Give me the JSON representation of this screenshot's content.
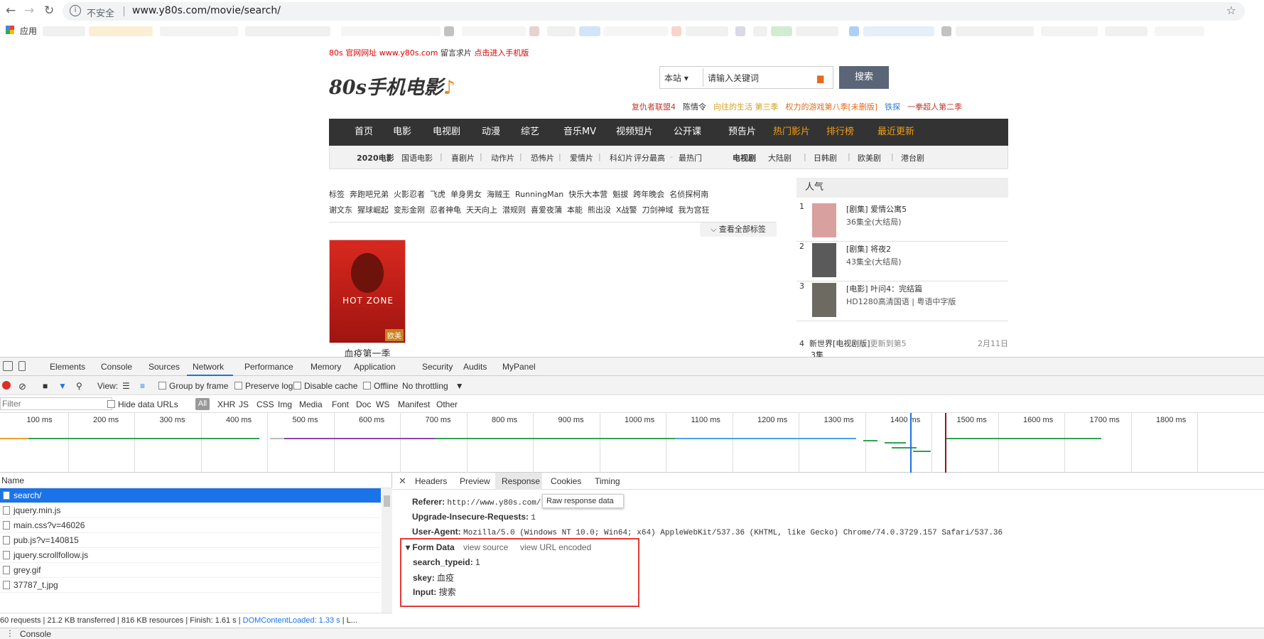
{
  "browser": {
    "back_icon": "back-arrow-icon",
    "forward_icon": "forward-arrow-icon",
    "reload_icon": "reload-icon",
    "security_label": "不安全",
    "url": "www.y80s.com/movie/search/",
    "bookmarks_apps_label": "应用"
  },
  "site": {
    "top_note_red": "80s 官网网址 www.y80s.com",
    "top_note_black": " 留言求片 ",
    "top_note_red2": "点击进入手机版",
    "logo_text": "80s手机电影",
    "logo_icon": "♪",
    "search_scope": "本站",
    "search_input_value": "请输入关键词",
    "search_button": "搜索",
    "hot_links": [
      {
        "text": "复仇者联盟4",
        "color": "#c0392b"
      },
      {
        "text": "陈情令",
        "color": "#333333"
      },
      {
        "text": "向往的生活 第三季",
        "color": "#d4a017"
      },
      {
        "text": "权力的游戏第八季[未删版]",
        "color": "#e36b1f"
      },
      {
        "text": "铁探",
        "color": "#2b7cd3"
      },
      {
        "text": "一拳超人第二季",
        "color": "#c0392b"
      }
    ],
    "main_nav": [
      {
        "label": "首页",
        "color": "#ffffff"
      },
      {
        "label": "电影",
        "color": "#ffffff"
      },
      {
        "label": "电视剧",
        "color": "#ffffff"
      },
      {
        "label": "动漫",
        "color": "#ffffff"
      },
      {
        "label": "综艺",
        "color": "#ffffff"
      },
      {
        "label": "音乐MV",
        "color": "#ffffff"
      },
      {
        "label": "视频短片",
        "color": "#ffffff"
      },
      {
        "label": "公开课",
        "color": "#ffffff"
      },
      {
        "label": "预告片",
        "color": "#ffffff"
      },
      {
        "label": "热门影片",
        "color": "#f39c12"
      },
      {
        "label": "排行榜",
        "color": "#f39c12"
      },
      {
        "label": "最近更新",
        "color": "#f39c12"
      }
    ],
    "sub_nav": [
      "2020电影",
      "国语电影",
      "|",
      "喜剧片",
      "|",
      "动作片",
      "|",
      "恐怖片",
      "|",
      "爱情片",
      "|",
      "科幻片",
      "评分最高",
      "-",
      "最热门",
      "电视剧",
      "大陆剧",
      "|",
      "日韩剧",
      "|",
      "欧美剧",
      "|",
      "港台剧"
    ],
    "tags_row1": [
      "标签",
      "奔跑吧兄弟",
      "火影忍者",
      "飞虎",
      "单身男女",
      "海贼王",
      "RunningMan",
      "快乐大本营",
      "魁拔",
      "跨年晚会",
      "名侦探柯南"
    ],
    "tags_row2": [
      "谢文东",
      "猩球崛起",
      "变形金刚",
      "忍者神龟",
      "天天向上",
      "潜规则",
      "喜爱夜蒲",
      "本能",
      "熊出没",
      "X战警",
      "刀剑神域",
      "我为宫狂"
    ],
    "view_all_tags": "查看全部标签",
    "result": {
      "poster_text": "HOT ZONE",
      "badge": "欧美",
      "title": "血疫第一季"
    },
    "popular_title": "人气",
    "popular": [
      {
        "rank": "1",
        "title": "[剧集] 爱情公寓5",
        "sub": "36集全(大结局)"
      },
      {
        "rank": "2",
        "title": "[剧集] 将夜2",
        "sub": "43集全(大结局)"
      },
      {
        "rank": "3",
        "title": "[电影] 叶问4：完结篇",
        "sub": "HD1280高清国语 | 粤语中字版"
      }
    ],
    "popular4": {
      "rank": "4",
      "title": "新世界[电视剧版]",
      "update": "更新到第5",
      "ep": "3集",
      "date": "2月11日"
    }
  },
  "devtools": {
    "tabs": [
      "Elements",
      "Console",
      "Sources",
      "Network",
      "Performance",
      "Memory",
      "Application",
      "Security",
      "Audits",
      "MyPanel"
    ],
    "active_tab": "Network",
    "toolbar": {
      "view_label": "View:",
      "group_by_frame": "Group by frame",
      "preserve_log": "Preserve log",
      "disable_cache": "Disable cache",
      "offline": "Offline",
      "throttling": "No throttling"
    },
    "filter": {
      "placeholder": "Filter",
      "hide_data_urls": "Hide data URLs",
      "types": [
        "All",
        "XHR",
        "JS",
        "CSS",
        "Img",
        "Media",
        "Font",
        "Doc",
        "WS",
        "Manifest",
        "Other"
      ]
    },
    "timeline_ticks": [
      "100 ms",
      "200 ms",
      "300 ms",
      "400 ms",
      "500 ms",
      "600 ms",
      "700 ms",
      "800 ms",
      "900 ms",
      "1000 ms",
      "1100 ms",
      "1200 ms",
      "1300 ms",
      "1400 ms",
      "1500 ms",
      "1600 ms",
      "1700 ms",
      "1800 ms"
    ],
    "list_header": "Name",
    "requests": [
      "search/",
      "jquery.min.js",
      "main.css?v=46026",
      "pub.js?v=140815",
      "jquery.scrollfollow.js",
      "grey.gif",
      "37787_t.jpg"
    ],
    "status_parts": [
      "60 requests",
      "21.2 KB transferred",
      "816 KB resources",
      "Finish: 1.61 s"
    ],
    "status_dcl": "DOMContentLoaded: 1.33 s",
    "status_more": "L...",
    "detail_tabs": [
      "Headers",
      "Preview",
      "Response",
      "Cookies",
      "Timing"
    ],
    "tooltip": "Raw response data",
    "headers": [
      {
        "key": "Referer:",
        "value": "http://www.y80s.com/"
      },
      {
        "key": "Upgrade-Insecure-Requests:",
        "value": "1"
      },
      {
        "key": "User-Agent:",
        "value": "Mozilla/5.0 (Windows NT 10.0; Win64; x64) AppleWebKit/537.36 (KHTML, like Gecko) Chrome/74.0.3729.157 Safari/537.36"
      }
    ],
    "form_data": {
      "title": "Form Data",
      "view_source": "view source",
      "view_url_encoded": "view URL encoded",
      "fields": [
        {
          "key": "search_typeid:",
          "value": "1"
        },
        {
          "key": "skey:",
          "value": "血疫"
        },
        {
          "key": "Input:",
          "value": "搜索"
        }
      ]
    },
    "console_label": "Console"
  }
}
